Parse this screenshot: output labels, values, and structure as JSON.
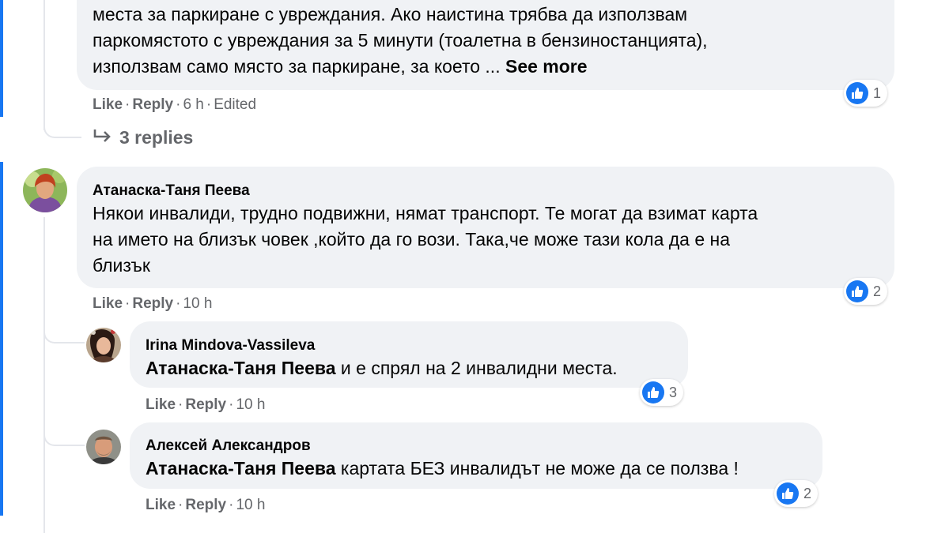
{
  "comment1": {
    "lines": [
      "места за паркиране с увреждания. Ако наистина трябва да използвам",
      "паркомястото с увреждания за 5 минути (тоалетна в бензиностанцията),",
      "използвам само място за паркиране, за което ..."
    ],
    "see_more": "See more",
    "like_label": "Like",
    "reply_label": "Reply",
    "time": "6 h",
    "edited": "Edited",
    "reactions": "1",
    "replies_label": "3 replies"
  },
  "comment2": {
    "author": "Атанаска-Таня Пеева",
    "lines": [
      "Някои инвалиди, трудно подвижни, нямат транспорт. Те могат да взимат карта",
      "на името на близък човек ,който да го вози. Така,че може тази кола да е на",
      "близък"
    ],
    "like_label": "Like",
    "reply_label": "Reply",
    "time": "10 h",
    "reactions": "2"
  },
  "reply1": {
    "author": "Irina Mindova-Vassileva",
    "mention": "Атанаска-Таня Пеева",
    "text": " и е спрял на 2 инвалидни места.",
    "like_label": "Like",
    "reply_label": "Reply",
    "time": "10 h",
    "reactions": "3"
  },
  "reply2": {
    "author": "Алексей Александров",
    "mention": "Атанаска-Таня Пеева",
    "text": " картата БЕЗ инвалидът не може да се ползва !",
    "like_label": "Like",
    "reply_label": "Reply",
    "time": "10 h",
    "reactions": "2"
  },
  "icons": {
    "reaction": "like-thumb-icon",
    "replies_arrow": "reply-arrow-icon"
  },
  "colors": {
    "accent": "#1877f2",
    "bubble": "#f0f2f5",
    "meta": "#65676b"
  }
}
